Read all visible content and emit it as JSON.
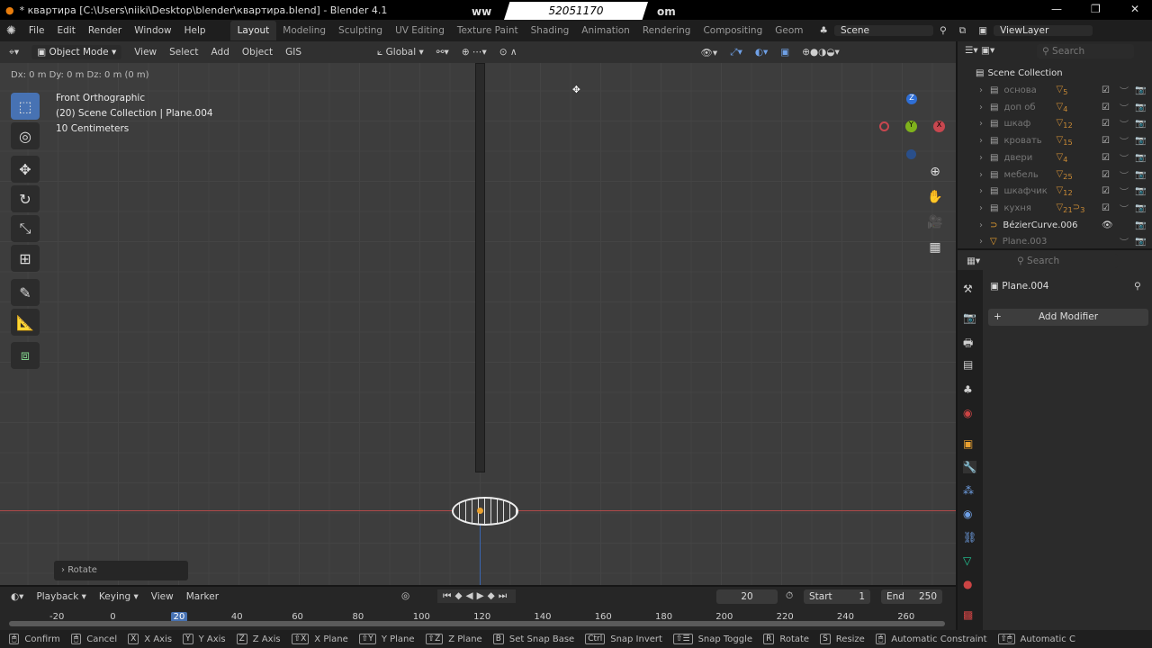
{
  "window": {
    "title": "* квартира [C:\\Users\\niiki\\Desktop\\blender\\квартира.blend] - Blender 4.1",
    "watermark": "52051170",
    "watermark_left": "ww",
    "watermark_right": "om"
  },
  "menu": [
    "File",
    "Edit",
    "Render",
    "Window",
    "Help"
  ],
  "workspaces": [
    "Layout",
    "Modeling",
    "Sculpting",
    "UV Editing",
    "Texture Paint",
    "Shading",
    "Animation",
    "Rendering",
    "Compositing",
    "Geom"
  ],
  "scene": "Scene",
  "view_layer": "ViewLayer",
  "viewport_header": {
    "mode": "Object Mode",
    "menus": [
      "View",
      "Select",
      "Add",
      "Object",
      "GIS"
    ],
    "orientation": "Global"
  },
  "delta": "Dx: 0 m   Dy: 0 m   Dz: 0 m (0 m)",
  "viewport_info": [
    "Front Orthographic",
    "(20) Scene Collection | Plane.004",
    "10 Centimeters"
  ],
  "gizmo": {
    "z": "Z",
    "y": "Y",
    "x": "X"
  },
  "operator_panel": "Rotate",
  "outliner": {
    "search_placeholder": "Search",
    "root": "Scene Collection",
    "items": [
      {
        "name": "основа",
        "count": "5"
      },
      {
        "name": "доп об",
        "count": "4"
      },
      {
        "name": "шкаф",
        "count": "12"
      },
      {
        "name": "кровать",
        "count": "15"
      },
      {
        "name": "двери",
        "count": "4"
      },
      {
        "name": "мебель",
        "count": "25"
      },
      {
        "name": "шкафчик",
        "count": "12"
      },
      {
        "name": "кухня",
        "count": "21",
        "extra": "3"
      },
      {
        "name": "BézierCurve.006"
      },
      {
        "name": "Plane.003"
      }
    ]
  },
  "properties": {
    "search_placeholder": "Search",
    "object": "Plane.004",
    "add_modifier": "Add Modifier"
  },
  "timeline": {
    "menus": [
      "Playback",
      "Keying",
      "View",
      "Marker"
    ],
    "current_frame": "20",
    "start_label": "Start",
    "start": "1",
    "end_label": "End",
    "end": "250",
    "ticks": [
      "-20",
      "0",
      "20",
      "40",
      "60",
      "80",
      "100",
      "120",
      "140",
      "160",
      "180",
      "200",
      "220",
      "240",
      "260"
    ]
  },
  "status": [
    {
      "k": "🖱",
      "t": "Confirm"
    },
    {
      "k": "🖱",
      "t": "Cancel"
    },
    {
      "k": "X",
      "t": "X Axis"
    },
    {
      "k": "Y",
      "t": "Y Axis"
    },
    {
      "k": "Z",
      "t": "Z Axis"
    },
    {
      "k": "⇧X",
      "t": "X Plane"
    },
    {
      "k": "⇧Y",
      "t": "Y Plane"
    },
    {
      "k": "⇧Z",
      "t": "Z Plane"
    },
    {
      "k": "B",
      "t": "Set Snap Base"
    },
    {
      "k": "Ctrl",
      "t": "Snap Invert"
    },
    {
      "k": "⇧☰",
      "t": "Snap Toggle"
    },
    {
      "k": "R",
      "t": "Rotate"
    },
    {
      "k": "S",
      "t": "Resize"
    },
    {
      "k": "🖱",
      "t": "Automatic Constraint"
    },
    {
      "k": "⇧🖱",
      "t": "Automatic C"
    }
  ],
  "colors": {
    "accent": "#4772b3",
    "x_axis": "#c8474f",
    "y_axis": "#7fb21c",
    "z_axis": "#2f6fd6",
    "object_orange": "#d99a3f"
  }
}
